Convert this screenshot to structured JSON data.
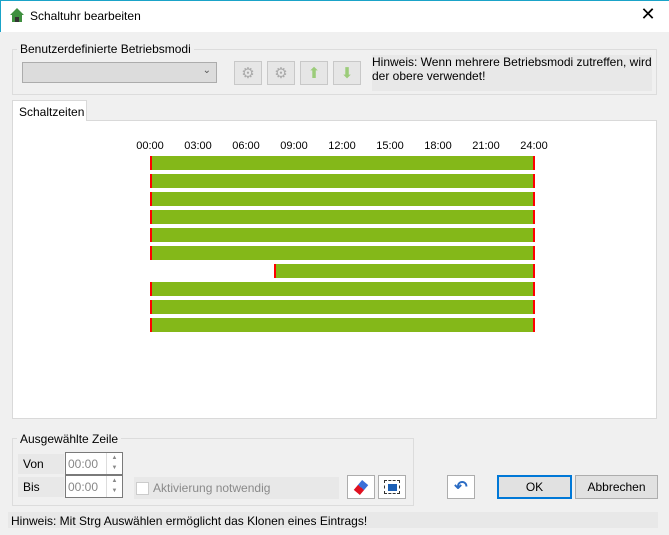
{
  "window": {
    "title": "Schaltuhr bearbeiten",
    "close": "✕",
    "icon": "home-icon"
  },
  "modes": {
    "group_label": "Benutzerdefinierte Betriebsmodi",
    "dropdown_value": "",
    "hint": "Hinweis: Wenn mehrere Betriebsmodi zutreffen, wird der obere verwendet!"
  },
  "tabs": [
    {
      "label": "Schaltzeiten",
      "active": true
    }
  ],
  "chart_data": {
    "type": "bar",
    "x_ticks": [
      "00:00",
      "03:00",
      "06:00",
      "09:00",
      "12:00",
      "15:00",
      "18:00",
      "21:00",
      "24:00"
    ],
    "xlim": [
      0,
      24
    ],
    "series": [
      {
        "name": "row1",
        "start": 0,
        "end": 24
      },
      {
        "name": "row2",
        "start": 0,
        "end": 24
      },
      {
        "name": "row3",
        "start": 0,
        "end": 24
      },
      {
        "name": "row4",
        "start": 0,
        "end": 24
      },
      {
        "name": "row5",
        "start": 0,
        "end": 24
      },
      {
        "name": "row6",
        "start": 0,
        "end": 24
      },
      {
        "name": "row7",
        "start": 7.75,
        "end": 24
      },
      {
        "name": "row8",
        "start": 0,
        "end": 24
      },
      {
        "name": "row9",
        "start": 0,
        "end": 24
      },
      {
        "name": "row10",
        "start": 0,
        "end": 24
      }
    ],
    "bar_color": "#84b819",
    "edge_color": "#ff0000"
  },
  "selected": {
    "group_label": "Ausgewählte Zeile",
    "von_label": "Von",
    "von_value": "00:00",
    "bis_label": "Bis",
    "bis_value": "00:00",
    "checkbox_label": "Aktivierung notwendig",
    "checked": false
  },
  "buttons": {
    "ok": "OK",
    "cancel": "Abbrechen"
  },
  "footer_hint": "Hinweis: Mit Strg Auswählen ermöglicht das Klonen eines Eintrags!"
}
